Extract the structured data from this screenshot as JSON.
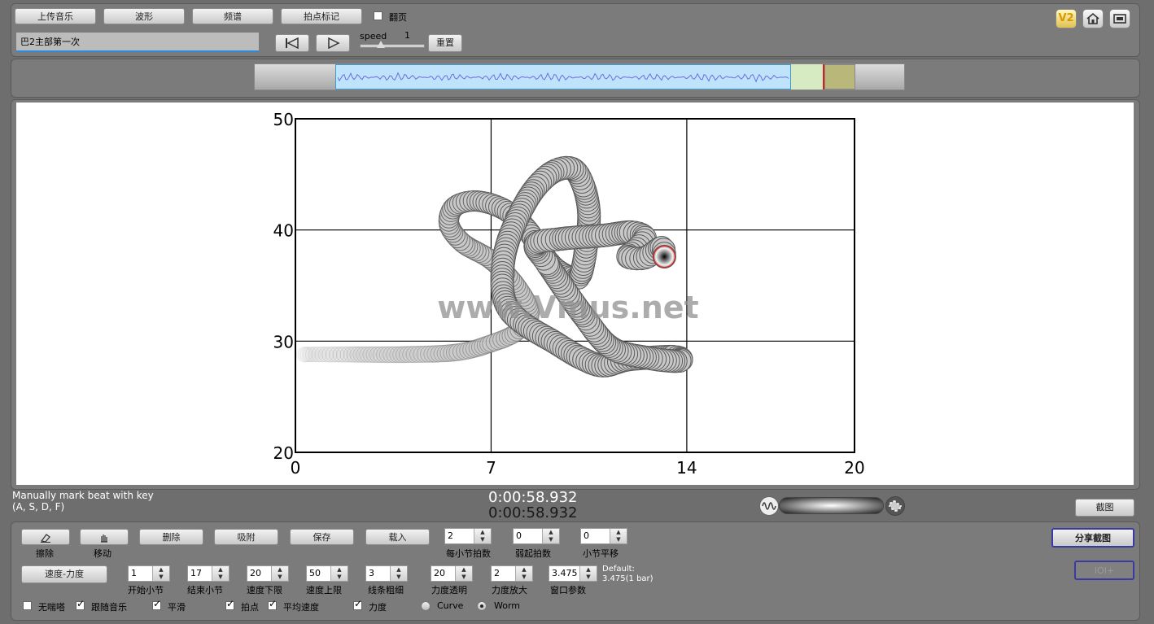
{
  "toolbar": {
    "upload": "上传音乐",
    "waveform": "波形",
    "spectrum": "频谱",
    "beat_mark": "拍点标记",
    "flip_page": "翻页",
    "speed_label": "speed",
    "speed_value": "1",
    "reset": "重置",
    "file_name": "巴2主部第一次",
    "v2": "V2"
  },
  "timeline": {
    "selection_start_fraction": 0.125,
    "selection_end_fraction": 0.825,
    "cursor_fraction": 0.873
  },
  "plot": {
    "watermark": "www.Vmus.net",
    "x_ticks": [
      "0",
      "7",
      "14",
      "20"
    ],
    "y_ticks": [
      "50",
      "40",
      "30",
      "20"
    ]
  },
  "chart_data": {
    "type": "line",
    "x_ticks": [
      0,
      7,
      14,
      20
    ],
    "y_ticks": [
      20,
      30,
      40,
      50
    ],
    "xlim": [
      0,
      20
    ],
    "ylim": [
      20,
      50
    ],
    "grid": true,
    "series": [
      {
        "x": [
          0.3,
          2,
          4,
          5.8,
          7,
          7.9,
          8.4,
          7.9,
          7,
          6,
          5.5,
          5.7,
          6.5,
          7.5,
          8.3,
          8.8,
          9.3,
          9.9,
          10.2,
          10.4,
          10.5,
          10.3,
          9.9,
          9.2,
          8.5,
          7.9,
          7.5,
          7.4,
          7.6,
          8.2,
          9.2,
          10.2,
          11,
          11.8,
          12.6,
          13.5,
          13.8,
          13.6,
          12.6,
          11.3,
          10.3,
          9,
          8.6,
          9.5,
          11,
          12,
          12.5,
          12.2,
          11.9,
          12.5,
          13.1,
          13.2
        ],
        "y": [
          28.8,
          28.8,
          28.8,
          29,
          29.8,
          30.8,
          32.5,
          35,
          37.3,
          38.8,
          40.5,
          42.1,
          42.6,
          41.8,
          40,
          38,
          36.5,
          35.7,
          36,
          38.5,
          41.5,
          44,
          45.5,
          45.2,
          43.5,
          40.8,
          38,
          35,
          33,
          31.5,
          30,
          28.5,
          27.8,
          28.3,
          28.5,
          28.6,
          28.4,
          28.2,
          28.5,
          29.4,
          32.3,
          37,
          38.7,
          39.2,
          39.5,
          39.8,
          39.3,
          38.3,
          37.6,
          37.5,
          38.4,
          37.6
        ]
      }
    ]
  },
  "status": {
    "hint1": "Manually mark beat with key",
    "hint2": "(A, S, D, F)",
    "time1": "0:00:58.932",
    "time2": "0:00:58.932",
    "screenshot": "截图"
  },
  "controls": {
    "erase_label": "擦除",
    "move_label": "移动",
    "delete": "删除",
    "snap": "吸附",
    "save": "保存",
    "load": "载入",
    "beats_per_bar": "2",
    "beats_per_bar_label": "每小节拍数",
    "pickup_beats": "0",
    "pickup_beats_label": "弱起拍数",
    "bar_shift": "0",
    "bar_shift_label": "小节平移",
    "share_screenshot": "分享截图",
    "tempo_dynamics": "速度-力度",
    "start_bar": "1",
    "start_bar_label": "开始小节",
    "end_bar": "17",
    "end_bar_label": "结束小节",
    "tempo_min": "20",
    "tempo_min_label": "速度下限",
    "tempo_max": "50",
    "tempo_max_label": "速度上限",
    "line_width": "3",
    "line_width_label": "线条粗细",
    "dyn_transparency": "20",
    "dyn_transparency_label": "力度透明",
    "dyn_zoom": "2",
    "dyn_zoom_label": "力度放大",
    "window_param": "3.475",
    "window_param_label": "窗口参数",
    "default_line1": "Default:",
    "default_line2": "3.475(1 bar)",
    "ioi_button": "IOI+",
    "no_shake": "无喘嗒",
    "follow_music": "跟随音乐",
    "smooth": "平滑",
    "beat_point": "拍点",
    "avg_speed": "平均速度",
    "dynamics": "力度",
    "curve": "Curve",
    "worm": "Worm"
  }
}
